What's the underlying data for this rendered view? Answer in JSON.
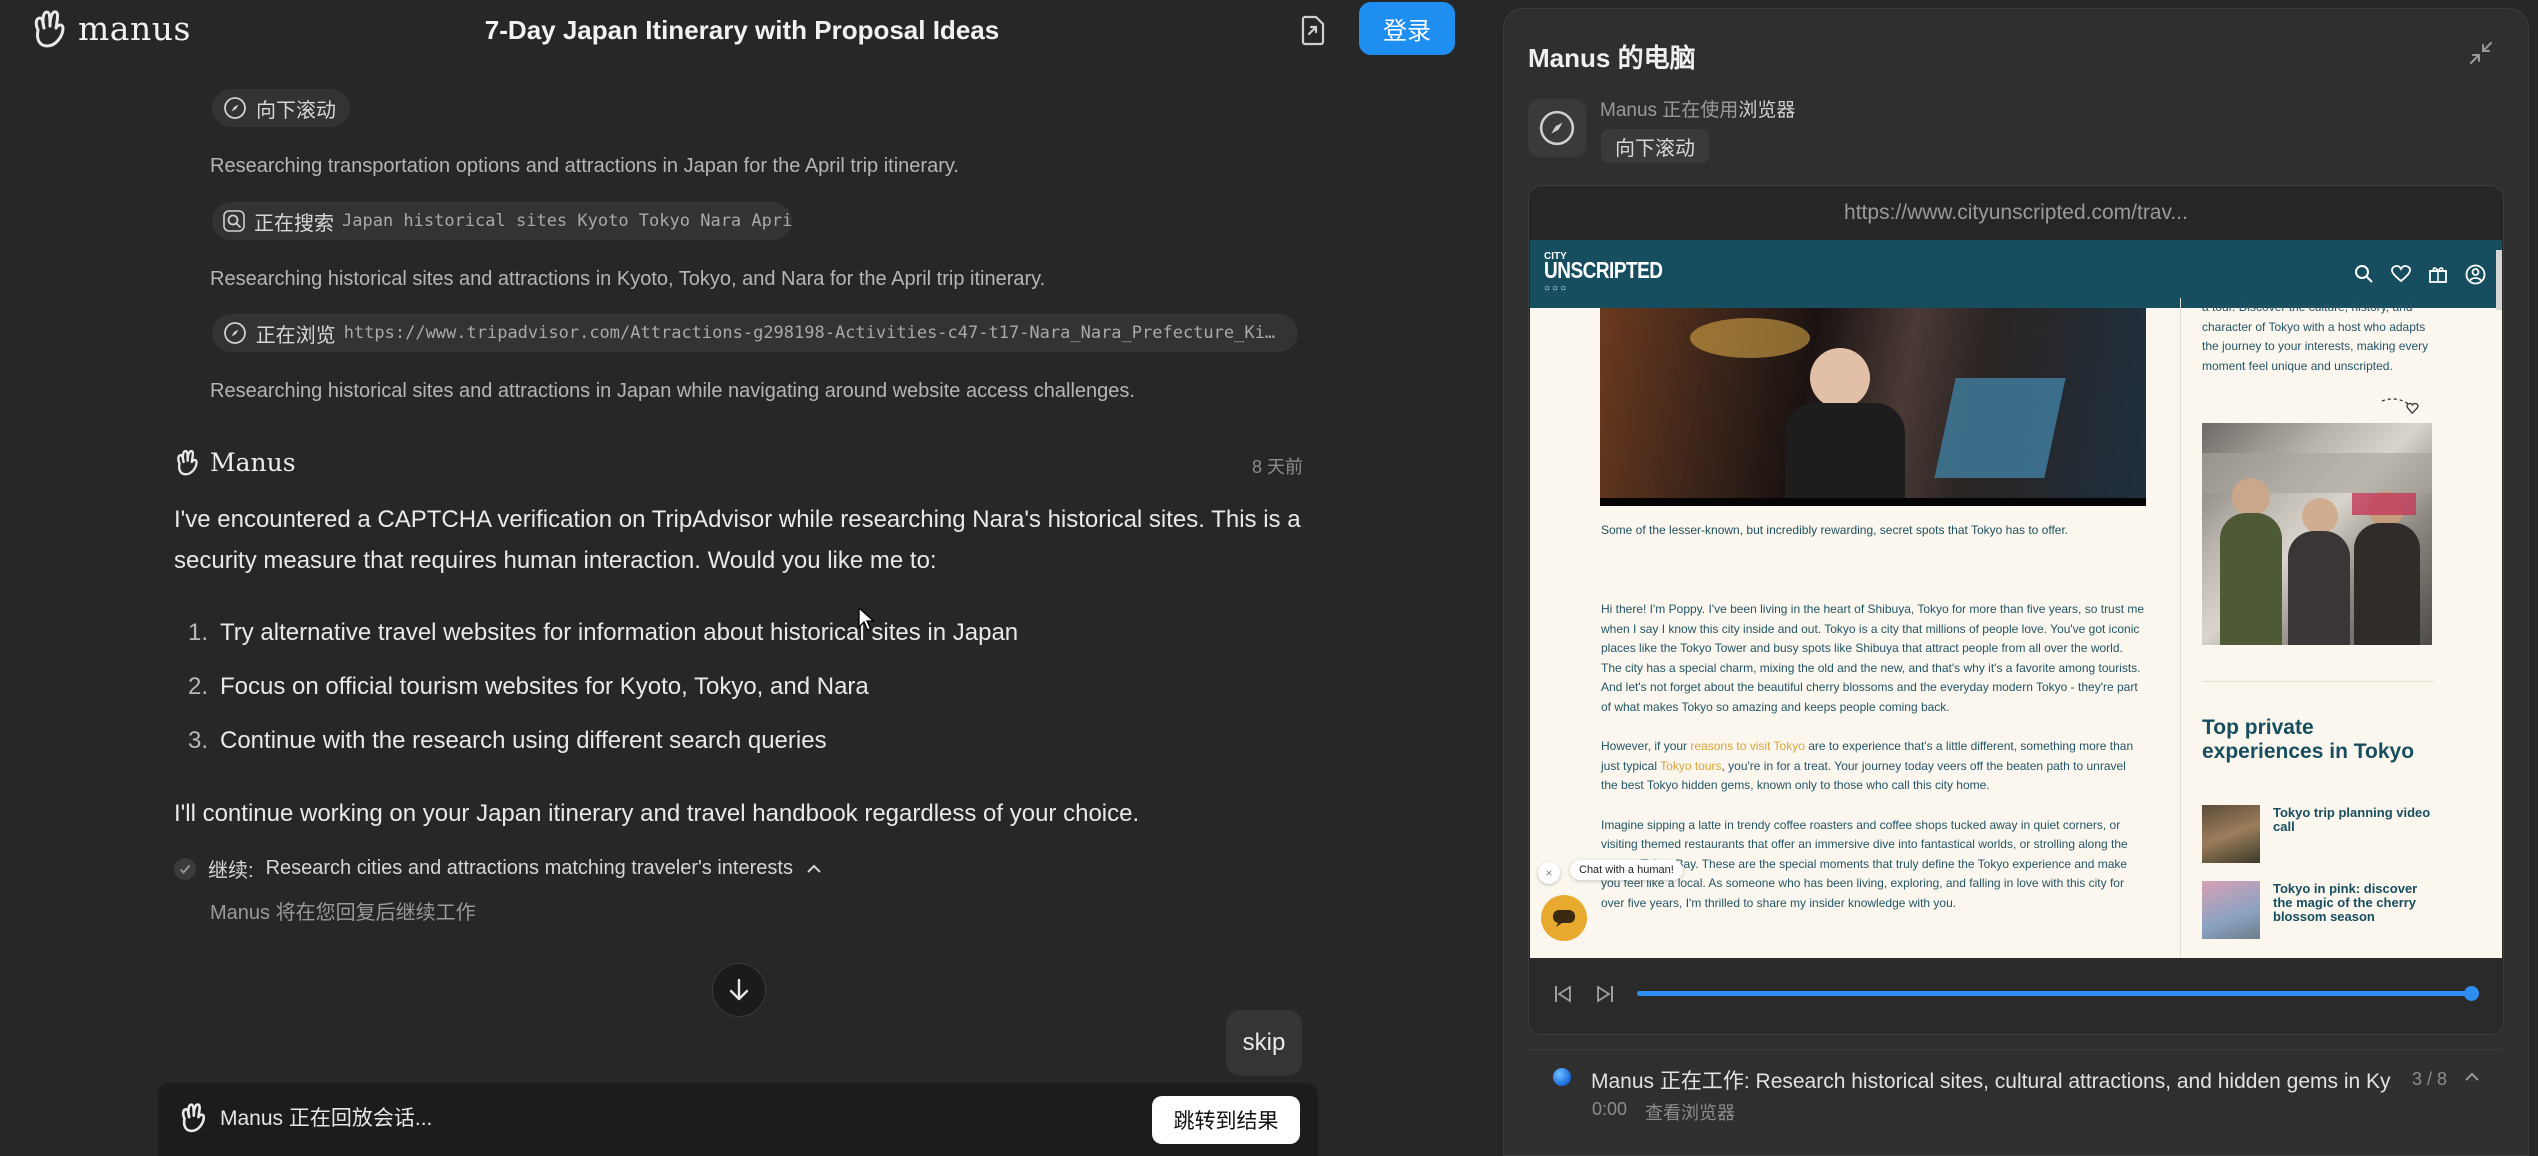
{
  "header": {
    "logo_text": "manus",
    "title": "7-Day Japan Itinerary with Proposal Ideas",
    "login": "登录"
  },
  "chat": {
    "steps": [
      {
        "pill_label": "向下滚动",
        "pill_detail": "",
        "icon": "compass-icon"
      },
      {
        "text": "Researching transportation options and attractions in Japan for the April trip itinerary."
      },
      {
        "pill_label": "正在搜索",
        "pill_detail": "Japan historical sites Kyoto Tokyo Nara April",
        "icon": "search-icon"
      },
      {
        "text": "Researching historical sites and attractions in Kyoto, Tokyo, and Nara for the April trip itinerary."
      },
      {
        "pill_label": "正在浏览",
        "pill_detail": "https://www.tripadvisor.com/Attractions-g298198-Activities-c47-t17-Nara_Nara_Prefecture_Kink…",
        "icon": "compass-icon"
      },
      {
        "text": "Researching historical sites and attractions in Japan while navigating around website access challenges."
      }
    ],
    "agent_name": "Manus",
    "time_ago": "8 天前",
    "message_intro": "I've encountered a CAPTCHA verification on TripAdvisor while researching Nara's historical sites. This is a security measure that requires human interaction. Would you like me to:",
    "options": [
      {
        "num": "1.",
        "text": "Try alternative travel websites for information about historical sites in Japan"
      },
      {
        "num": "2.",
        "text": "Focus on official tourism websites for Kyoto, Tokyo, and Nara"
      },
      {
        "num": "3.",
        "text": "Continue with the research using different search queries"
      }
    ],
    "message_outro": "I'll continue working on your Japan itinerary and travel handbook regardless of your choice.",
    "continue_label": "继续:",
    "continue_text": "Research cities and attractions matching traveler's interests",
    "resume_note": "Manus 将在您回复后继续工作",
    "skip": "skip",
    "replay_status": "Manus 正在回放会话...",
    "jump_to_result": "跳转到结果"
  },
  "computer": {
    "title": "Manus 的电脑",
    "using_prefix": "Manus 正在使用",
    "using_tool": "浏览器",
    "current_action": "向下滚动",
    "url": "https://www.cityunscripted.com/trav...",
    "site": {
      "logo_small": "CITY",
      "logo_big": "UNSCRIPTED",
      "video_caption": "Some of the lesser-known, but incredibly rewarding, secret spots that Tokyo has to offer.",
      "para1": "Hi there! I'm Poppy. I've been living in the heart of Shibuya, Tokyo for more than five years, so trust me when I say I know this city inside and out. Tokyo is a city that millions of people love. You've got iconic places like the Tokyo Tower and busy spots like Shibuya that attract people from all over the world. The city has a special charm, mixing the old and the new, and that's why it's a favorite among tourists. And let's not forget about the beautiful cherry blossoms and the everyday modern Tokyo - they're part of what makes Tokyo so amazing and keeps people coming back.",
      "para2_a": "However, if your ",
      "para2_link1": "reasons to visit Tokyo",
      "para2_b": " are to experience that's a little different, something more than just typical ",
      "para2_link2": "Tokyo tours",
      "para2_c": ", you're in for a treat. Your journey today veers off the beaten path to unravel the best Tokyo hidden gems, known only to those who call this city home.",
      "para3": "Imagine sipping a latte in trendy coffee roasters and coffee shops tucked away in quiet corners, or visiting themed restaurants that offer an immersive dive into fantastical worlds, or strolling along the serene Tokyo Bay. These are the special moments that truly define the Tokyo experience and make you feel like a local. As someone who has been living, exploring, and falling in love with this city for over five years, I'm thrilled to share my insider knowledge with you.",
      "chat_bubble": "Chat with a human!",
      "sidebar_intro": "a tour. Discover the culture, history, and character of Tokyo with a host who adapts the journey to your interests, making every moment feel unique and unscripted.",
      "sidebar_heading": "Top private experiences in Tokyo",
      "sidebar_items": [
        {
          "title": "Tokyo trip planning video call"
        },
        {
          "title": "Tokyo in pink: discover the magic of the cherry blossom season"
        }
      ],
      "accent_color": "#174e5f",
      "link_color": "#d9a43a"
    },
    "progress_fraction": 1.0,
    "task_status": "Manus 正在工作: Research historical sites, cultural attractions, and hidden gems in Ky...",
    "task_time": "0:00",
    "task_view": "查看浏览器",
    "task_counter": "3 / 8"
  }
}
